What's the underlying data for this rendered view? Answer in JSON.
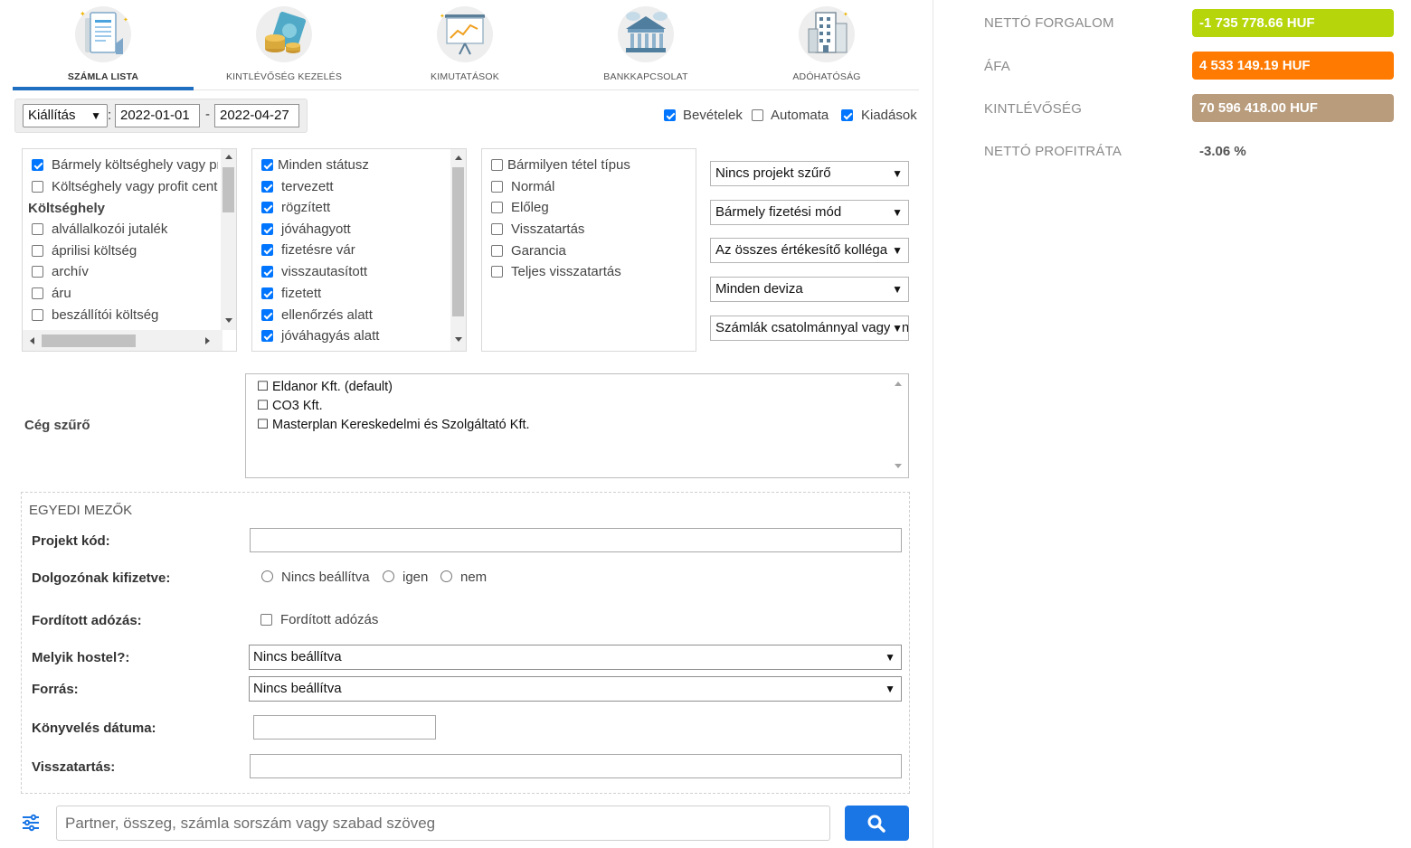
{
  "nav": {
    "tabs": [
      {
        "label": "SZÁMLA LISTA",
        "icon": "invoice-list-icon",
        "active": true
      },
      {
        "label": "KINTLÉVŐSÉG KEZELÉS",
        "icon": "receivables-coins-icon",
        "active": false
      },
      {
        "label": "KIMUTATÁSOK",
        "icon": "report-chart-icon",
        "active": false
      },
      {
        "label": "BANKKAPCSOLAT",
        "icon": "bank-building-icon",
        "active": false
      },
      {
        "label": "ADÓHATÓSÁG",
        "icon": "tax-office-building-icon",
        "active": false
      }
    ]
  },
  "date_filter": {
    "type_value": "Kiállítás",
    "from": "2022-01-01",
    "to": "2022-04-27",
    "colon": ":",
    "dash": "-"
  },
  "type_checks": [
    {
      "label": "Bevételek",
      "checked": true
    },
    {
      "label": "Automata",
      "checked": false
    },
    {
      "label": "Kiadások",
      "checked": true
    }
  ],
  "cost_centers": {
    "items": [
      {
        "label": "Bármely költséghely vagy profit center",
        "checked": true
      },
      {
        "label": "Költséghely vagy profit center nélkül",
        "checked": false
      }
    ],
    "group_header": "Költséghely",
    "group_items": [
      {
        "label": "alvállalkozói jutalék",
        "checked": false
      },
      {
        "label": "áprilisi költség",
        "checked": false
      },
      {
        "label": "archív",
        "checked": false
      },
      {
        "label": "áru",
        "checked": false
      },
      {
        "label": "beszállítói költség",
        "checked": false
      }
    ]
  },
  "statuses": [
    {
      "label": "Minden státusz",
      "checked": true
    },
    {
      "label": "tervezett",
      "checked": true
    },
    {
      "label": "rögzített",
      "checked": true
    },
    {
      "label": "jóváhagyott",
      "checked": true
    },
    {
      "label": "fizetésre vár",
      "checked": true
    },
    {
      "label": "visszautasított",
      "checked": true
    },
    {
      "label": "fizetett",
      "checked": true
    },
    {
      "label": "ellenőrzés alatt",
      "checked": true
    },
    {
      "label": "jóváhagyás alatt",
      "checked": true
    }
  ],
  "item_types": [
    {
      "label": "Bármilyen tétel típus",
      "checked": false
    },
    {
      "label": "Normál",
      "checked": false
    },
    {
      "label": "Előleg",
      "checked": false
    },
    {
      "label": "Visszatartás",
      "checked": false
    },
    {
      "label": "Garancia",
      "checked": false
    },
    {
      "label": "Teljes visszatartás",
      "checked": false
    }
  ],
  "right_selects": [
    "Nincs projekt szűrő",
    "Bármely fizetési mód",
    "Az összes értékesítő kolléga",
    "Minden deviza",
    "Számlák csatolmánnyal vagy anélkül"
  ],
  "caret": "▼",
  "company_filter": {
    "label": "Cég szűrő",
    "items": [
      "☐ Eldanor Kft. (default)",
      "☐ CO3 Kft.",
      "☐ Masterplan Kereskedelmi és Szolgáltató Kft."
    ]
  },
  "custom_fields": {
    "legend": "EGYEDI MEZŐK",
    "projekt_kod": {
      "label": "Projekt kód:",
      "value": ""
    },
    "dolgozonak": {
      "label": "Dolgozónak kifizetve:",
      "options": [
        "Nincs beállítva",
        "igen",
        "nem"
      ]
    },
    "forditott": {
      "label": "Fordított adózás:",
      "checkbox_label": "Fordított adózás",
      "checked": false
    },
    "hostel": {
      "label": "Melyik hostel?:",
      "value": "Nincs beállítva"
    },
    "forras": {
      "label": "Forrás:",
      "value": "Nincs beállítva"
    },
    "konyveles": {
      "label": "Könyvelés dátuma:",
      "value": ""
    },
    "visszatartas": {
      "label": "Visszatartás:",
      "value": ""
    }
  },
  "search": {
    "placeholder": "Partner, összeg, számla sorszám vagy szabad szöveg"
  },
  "stats": [
    {
      "label": "NETTÓ FORGALOM",
      "value": "-1 735 778.66 HUF",
      "color": "#b6d60b"
    },
    {
      "label": "ÁFA",
      "value": "4 533 149.19 HUF",
      "color": "#ff7a00"
    },
    {
      "label": "KINTLÉVŐSÉG",
      "value": "70 596 418.00 HUF",
      "color": "#b89c7c"
    },
    {
      "label": "NETTÓ PROFITRÁTA",
      "value": "-3.06 %",
      "color": ""
    }
  ]
}
